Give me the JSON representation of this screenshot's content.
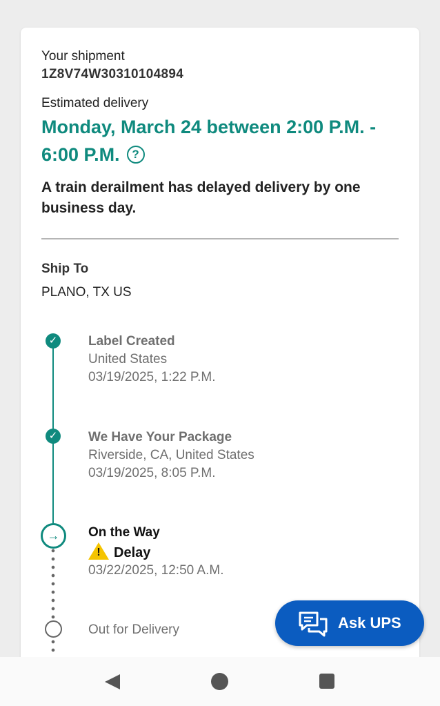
{
  "shipment": {
    "label": "Your shipment",
    "tracking_number": "1Z8V74W30310104894"
  },
  "delivery": {
    "label": "Estimated delivery",
    "window": "Monday, March 24 between 2:00 P.M. - 6:00 P.M.",
    "help_icon": "question-circle-icon",
    "alert_message": "A train derailment has delayed delivery by one business day."
  },
  "ship_to": {
    "label": "Ship To",
    "value": "PLANO, TX US"
  },
  "timeline": [
    {
      "title": "Label Created",
      "location": "United States",
      "datetime": "03/19/2025, 1:22 P.M.",
      "status": "completed"
    },
    {
      "title": "We Have Your Package",
      "location": "Riverside, CA, United States",
      "datetime": "03/19/2025, 8:05 P.M.",
      "status": "completed"
    },
    {
      "title": "On the Way",
      "alert": "Delay",
      "datetime": "03/22/2025, 12:50 A.M.",
      "status": "current"
    },
    {
      "title": "Out for Delivery",
      "status": "pending"
    }
  ],
  "ask_button": {
    "label": "Ask UPS",
    "icon": "chat-bubbles-icon"
  },
  "colors": {
    "accent": "#0f8a7e",
    "button": "#0b5cc0",
    "warning": "#f5c400"
  }
}
